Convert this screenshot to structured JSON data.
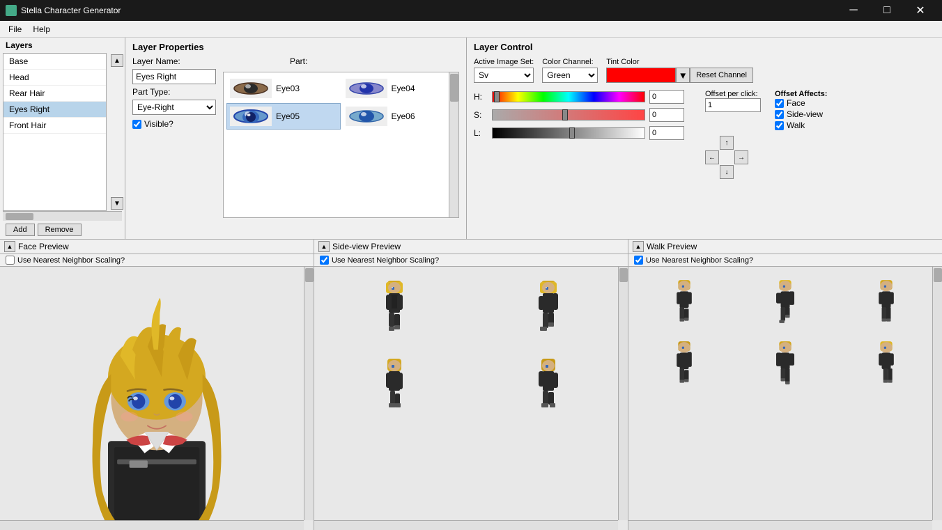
{
  "titlebar": {
    "title": "Stella Character Generator",
    "minimize": "─",
    "maximize": "□",
    "close": "✕"
  },
  "menubar": {
    "items": [
      "File",
      "Help"
    ]
  },
  "layers": {
    "header": "Layers",
    "items": [
      {
        "label": "Base",
        "selected": false
      },
      {
        "label": "Head",
        "selected": false
      },
      {
        "label": "Rear Hair",
        "selected": false
      },
      {
        "label": "Eyes Right",
        "selected": true
      },
      {
        "label": "Front Hair",
        "selected": false
      }
    ],
    "add_btn": "Add",
    "remove_btn": "Remove"
  },
  "layer_props": {
    "header": "Layer Properties",
    "name_label": "Layer Name:",
    "name_value": "Eyes Right",
    "part_label": "Part:",
    "part_type_label": "Part Type:",
    "part_type_value": "Eye-Right",
    "visible_label": "Visible?",
    "parts": [
      {
        "label": "Eye03",
        "col": 0
      },
      {
        "label": "Eye04",
        "col": 1
      },
      {
        "label": "Eye05",
        "col": 0
      },
      {
        "label": "Eye06",
        "col": 1
      }
    ]
  },
  "layer_control": {
    "header": "Layer Control",
    "active_image_label": "Active Image Set:",
    "active_image_value": "Sv",
    "color_channel_label": "Color Channel:",
    "color_channel_value": "Green",
    "tint_label": "Tint Color",
    "tint_color": "#ff0000",
    "reset_btn": "Reset Channel",
    "h_label": "H:",
    "h_value": "0",
    "s_label": "S:",
    "s_value": "0",
    "l_label": "L:",
    "l_value": "0",
    "offset_per_click_label": "Offset per click:",
    "offset_value": "1",
    "offset_affects_label": "Offset Affects:",
    "face_label": "Face",
    "sideview_label": "Side-view",
    "walk_label": "Walk",
    "face_checked": true,
    "sideview_checked": true,
    "walk_checked": true,
    "dir_up": "↑",
    "dir_left": "←",
    "dir_right": "→",
    "dir_down": "↓"
  },
  "previews": {
    "face": {
      "title": "Face Preview",
      "nn_scaling": "Use Nearest Neighbor Scaling?",
      "nn_checked": false
    },
    "sideview": {
      "title": "Side-view Preview",
      "nn_scaling": "Use Nearest Neighbor Scaling?",
      "nn_checked": true
    },
    "walk": {
      "title": "Walk Preview",
      "nn_scaling": "Use Nearest Neighbor Scaling?",
      "nn_checked": true
    }
  }
}
